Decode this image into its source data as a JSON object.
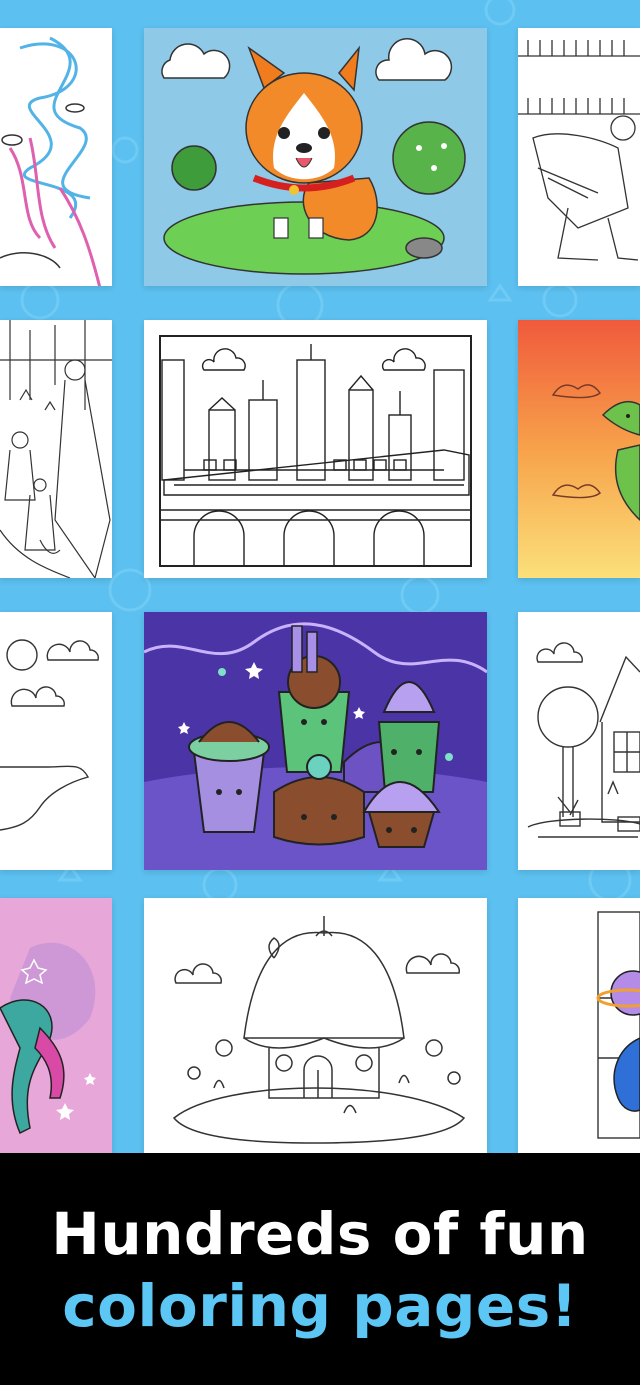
{
  "banner": {
    "line1": "Hundreds of fun",
    "line2": "coloring pages!"
  },
  "colors": {
    "background": "#5cc0f0",
    "banner_background": "#000000",
    "headline_primary": "#ffffff",
    "headline_accent": "#5cc6f4"
  },
  "gallery": {
    "pages": [
      {
        "subject": "sea-scribble",
        "state": "colored"
      },
      {
        "subject": "corgi",
        "state": "colored"
      },
      {
        "subject": "hockey-player",
        "state": "outline"
      },
      {
        "subject": "park-crowd",
        "state": "outline"
      },
      {
        "subject": "city-train",
        "state": "outline"
      },
      {
        "subject": "dragon",
        "state": "colored"
      },
      {
        "subject": "lake",
        "state": "outline"
      },
      {
        "subject": "cupcakes",
        "state": "colored"
      },
      {
        "subject": "house-garden",
        "state": "outline"
      },
      {
        "subject": "dancer",
        "state": "colored"
      },
      {
        "subject": "flower-house",
        "state": "outline"
      },
      {
        "subject": "planet",
        "state": "partial"
      }
    ]
  }
}
